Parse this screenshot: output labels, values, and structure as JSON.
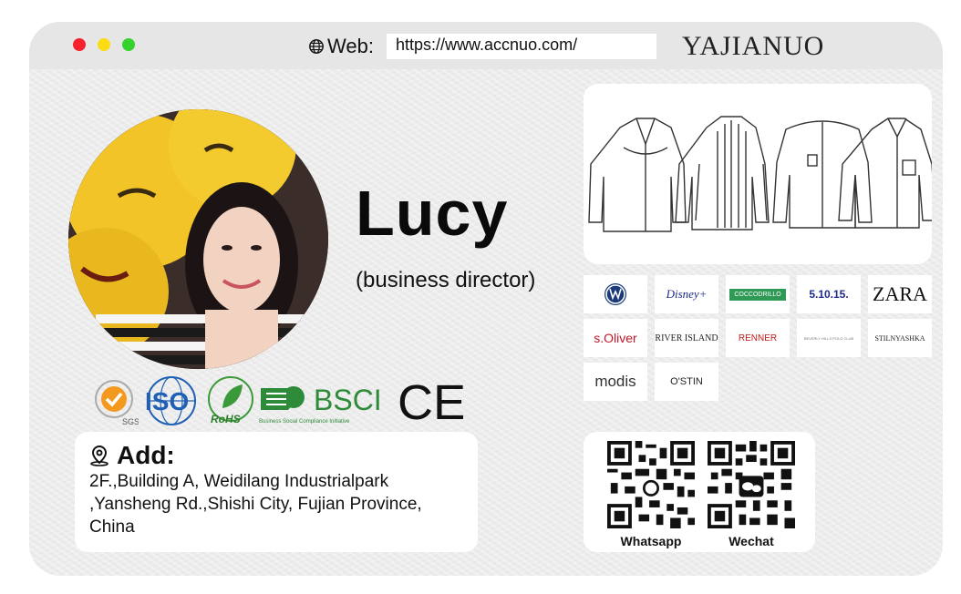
{
  "header": {
    "web_label": "Web:",
    "url": "https://www.accnuo.com/",
    "brand": "YAJIANUO"
  },
  "profile": {
    "name": "Lucy",
    "role": "(business director)"
  },
  "certifications": {
    "sgs": "SGS",
    "iso": "ISO",
    "rohs": "RoHS",
    "bsci": "BSCI",
    "bsci_sub": "Business Social Compliance Initiative",
    "ce": "CE"
  },
  "address": {
    "title": "Add:",
    "lines": [
      "2F.,Building A, Weidilang Industrialpark",
      ",Yansheng Rd.,Shishi City, Fujian Province,",
      "China"
    ]
  },
  "brands": [
    {
      "label": "VW"
    },
    {
      "label": "Disney+"
    },
    {
      "label": "COCCODRILLO"
    },
    {
      "label": "5.10.15."
    },
    {
      "label": "ZARA"
    },
    {
      "label": "s.Oliver"
    },
    {
      "label": "RIVER ISLAND"
    },
    {
      "label": "RENNER"
    },
    {
      "label": "BEVERLY HILLS POLO CLUB"
    },
    {
      "label": "STILNYASHKA"
    },
    {
      "label": "modis"
    },
    {
      "label": "O'STIN"
    }
  ],
  "qr": {
    "whatsapp_label": "Whatsapp",
    "wechat_label": "Wechat"
  },
  "colors": {
    "dot_red": "#f5222d",
    "dot_yellow": "#fadb14",
    "dot_green": "#35d12d",
    "bsci_green": "#2e8b3a",
    "iso_blue": "#1f5fb5"
  }
}
